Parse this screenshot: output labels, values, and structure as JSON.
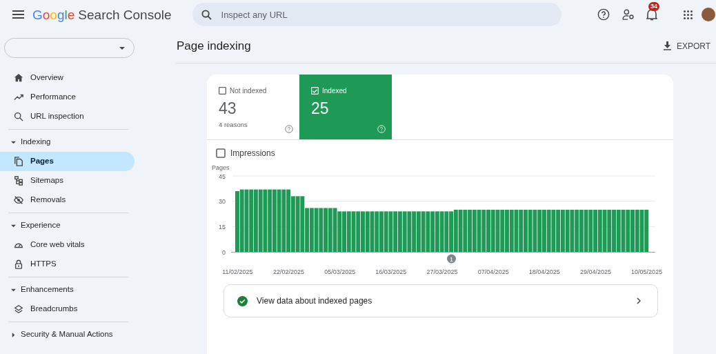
{
  "app": {
    "logo": "Google",
    "title": "Search Console"
  },
  "search": {
    "placeholder": "Inspect any URL"
  },
  "notifications": {
    "badge": "34"
  },
  "sidebar": {
    "items": [
      {
        "label": "Overview",
        "selected": false
      },
      {
        "label": "Performance",
        "selected": false
      },
      {
        "label": "URL inspection",
        "selected": false
      }
    ],
    "sections": [
      {
        "title": "Indexing",
        "expanded": true,
        "items": [
          {
            "label": "Pages",
            "selected": true
          },
          {
            "label": "Sitemaps",
            "selected": false
          },
          {
            "label": "Removals",
            "selected": false
          }
        ]
      },
      {
        "title": "Experience",
        "expanded": true,
        "items": [
          {
            "label": "Core web vitals",
            "selected": false
          },
          {
            "label": "HTTPS",
            "selected": false
          }
        ]
      },
      {
        "title": "Enhancements",
        "expanded": true,
        "items": [
          {
            "label": "Breadcrumbs",
            "selected": false
          }
        ]
      },
      {
        "title": "Security & Manual Actions",
        "expanded": false
      }
    ]
  },
  "page": {
    "title": "Page indexing",
    "export_label": "EXPORT"
  },
  "summary_tiles": [
    {
      "label": "Not indexed",
      "value": "43",
      "subtitle": "4 reasons",
      "selected": false
    },
    {
      "label": "Indexed",
      "value": "25",
      "selected": true
    }
  ],
  "impressions": {
    "label": "Impressions",
    "checked": false
  },
  "chart": {
    "chart_data": {
      "type": "bar",
      "ylabel": "Pages",
      "ylim": [
        0,
        45
      ],
      "yticks": [
        0,
        15,
        30,
        45
      ],
      "categories": [
        "11/02/2025",
        null,
        null,
        null,
        null,
        null,
        null,
        null,
        null,
        null,
        null,
        "22/02/2025",
        null,
        null,
        null,
        null,
        null,
        null,
        null,
        null,
        null,
        null,
        "05/03/2025",
        null,
        null,
        null,
        null,
        null,
        null,
        null,
        null,
        null,
        null,
        "16/03/2025",
        null,
        null,
        null,
        null,
        null,
        null,
        null,
        null,
        null,
        null,
        "27/03/2025",
        null,
        null,
        null,
        null,
        null,
        null,
        null,
        null,
        null,
        null,
        "07/04/2025",
        null,
        null,
        null,
        null,
        null,
        null,
        null,
        null,
        null,
        null,
        "18/04/2025",
        null,
        null,
        null,
        null,
        null,
        null,
        null,
        null,
        null,
        null,
        "29/04/2025",
        null,
        null,
        null,
        null,
        null,
        null,
        null,
        null,
        null,
        null,
        "10/05/2025"
      ],
      "series": [
        {
          "color": "#1e9a56",
          "values": [
            36,
            37,
            37,
            37,
            37,
            37,
            37,
            37,
            37,
            37,
            37,
            37,
            33,
            33,
            33,
            26,
            26,
            26,
            26,
            26,
            26,
            26,
            24,
            24,
            24,
            24,
            24,
            24,
            24,
            24,
            24,
            24,
            24,
            24,
            24,
            24,
            24,
            24,
            24,
            24,
            24,
            24,
            24,
            24,
            24,
            24,
            24,
            25,
            25,
            25,
            25,
            25,
            25,
            25,
            25,
            25,
            25,
            25,
            25,
            25,
            25,
            25,
            25,
            25,
            25,
            25,
            25,
            25,
            25,
            25,
            25,
            25,
            25,
            25,
            25,
            25,
            25,
            25,
            25,
            25,
            25,
            25,
            25,
            25,
            25,
            25,
            25,
            25,
            25
          ]
        }
      ],
      "annotations": [
        "1"
      ]
    }
  },
  "details_link": {
    "label": "View data about indexed pages"
  }
}
